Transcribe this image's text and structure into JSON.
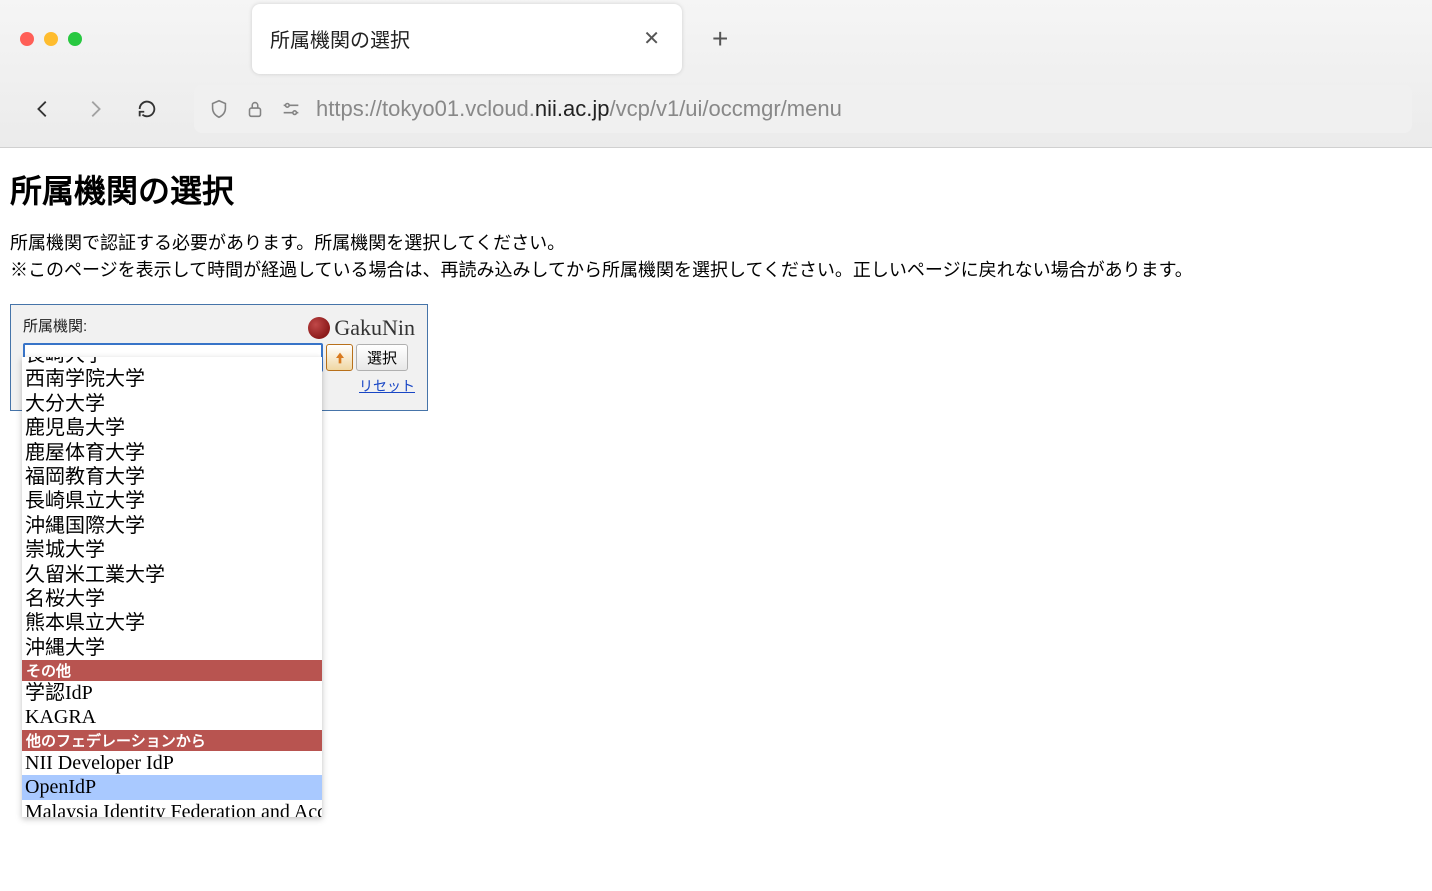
{
  "browser": {
    "tab_title": "所属機関の選択",
    "url_prefix": "https://tokyo01.vcloud.",
    "url_emph": "nii.ac.jp",
    "url_suffix": "/vcp/v1/ui/occmgr/menu"
  },
  "page": {
    "heading": "所属機関の選択",
    "desc_line1": "所属機関で認証する必要があります。所属機関を選択してください。",
    "desc_line2": "※このページを表示して時間が経過している場合は、再読み込みしてから所属機関を選択してください。正しいページに戻れない場合があります。"
  },
  "selector": {
    "label": "所属機関:",
    "brand": "GakuNin",
    "select_button": "選択",
    "reset": "リセット",
    "input_value": ""
  },
  "dropdown": {
    "items": [
      {
        "type": "item",
        "label": "長崎大学",
        "cutoff": true
      },
      {
        "type": "item",
        "label": "西南学院大学"
      },
      {
        "type": "item",
        "label": "大分大学"
      },
      {
        "type": "item",
        "label": "鹿児島大学"
      },
      {
        "type": "item",
        "label": "鹿屋体育大学"
      },
      {
        "type": "item",
        "label": "福岡教育大学"
      },
      {
        "type": "item",
        "label": "長崎県立大学"
      },
      {
        "type": "item",
        "label": "沖縄国際大学"
      },
      {
        "type": "item",
        "label": "崇城大学"
      },
      {
        "type": "item",
        "label": "久留米工業大学"
      },
      {
        "type": "item",
        "label": "名桜大学"
      },
      {
        "type": "item",
        "label": "熊本県立大学"
      },
      {
        "type": "item",
        "label": "沖縄大学"
      },
      {
        "type": "header",
        "label": "その他"
      },
      {
        "type": "item",
        "label": "学認IdP"
      },
      {
        "type": "item",
        "label": "KAGRA"
      },
      {
        "type": "header",
        "label": "他のフェデレーションから"
      },
      {
        "type": "item",
        "label": "NII Developer IdP"
      },
      {
        "type": "item",
        "label": "OpenIdP",
        "highlighted": true
      },
      {
        "type": "item",
        "label": "Malaysia Identity Federation and Access Management"
      }
    ]
  }
}
